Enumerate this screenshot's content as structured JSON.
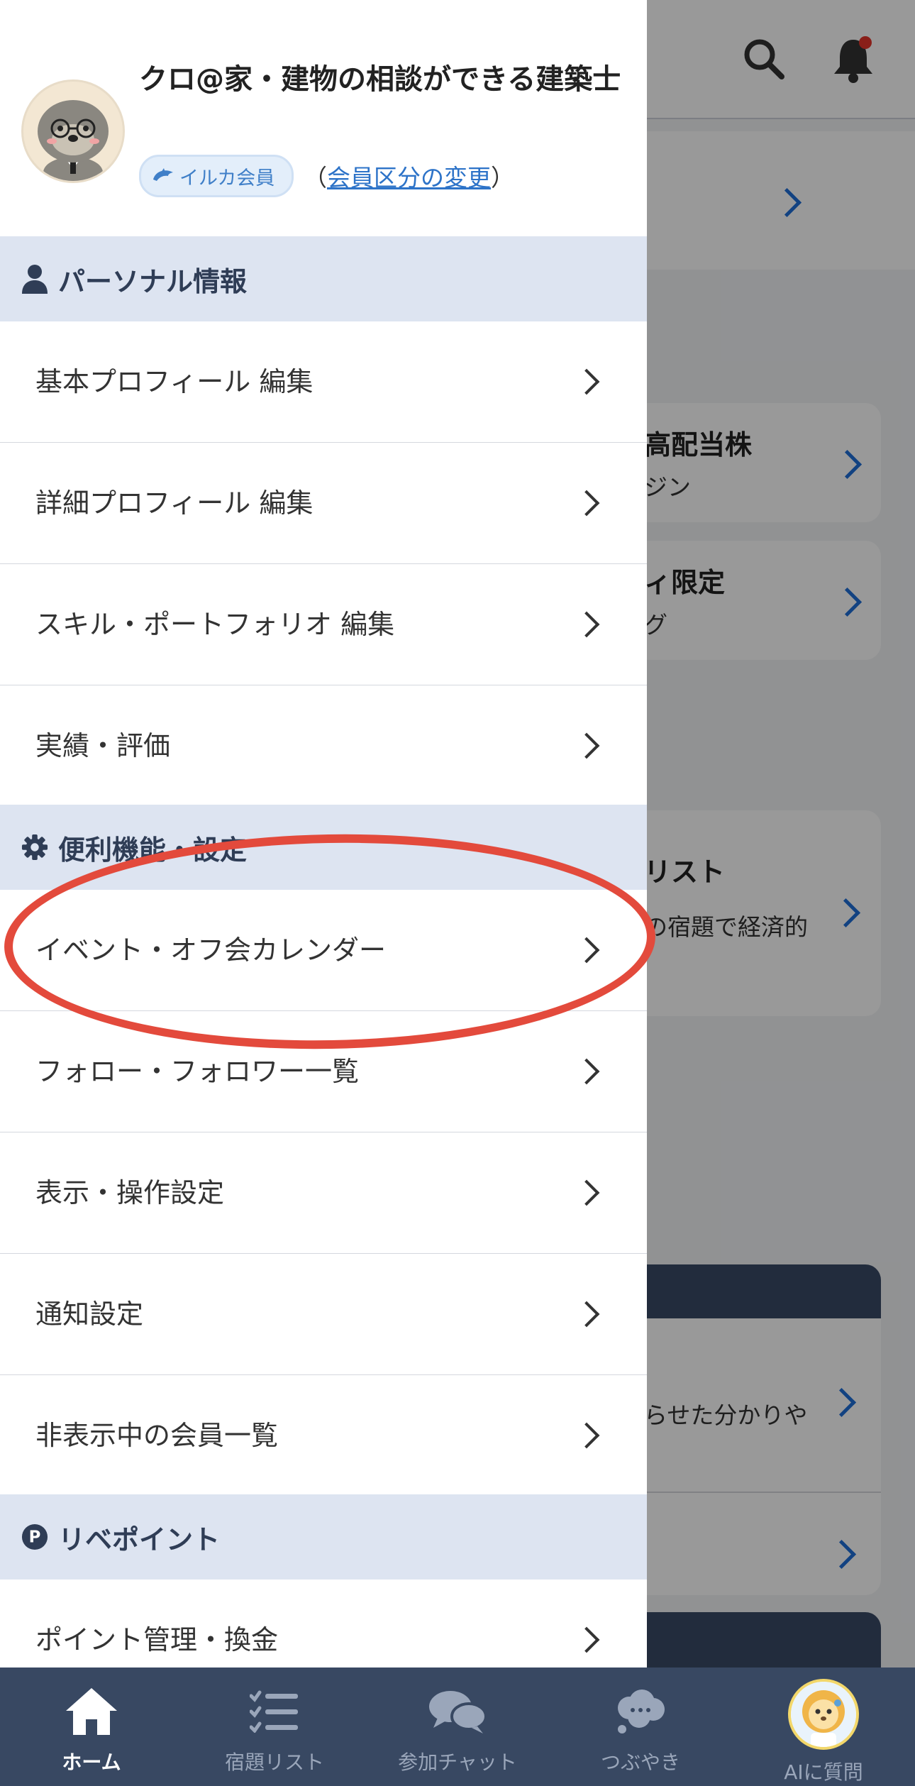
{
  "background": {
    "cards": [
      {
        "title": "高配当株",
        "sub": "ジン"
      },
      {
        "title": "ィ限定",
        "sub": "グ"
      },
      {
        "title": "リスト",
        "sub": "の宿題で経済的"
      }
    ],
    "lower_snippet": "らせた分かりや"
  },
  "profile": {
    "name": "クロ@家・建物の相談ができる建築士",
    "badge": "イルカ会員",
    "paren_open": "（",
    "change_link": "会員区分の変更",
    "paren_close": "）"
  },
  "sections": [
    {
      "label": "パーソナル情報",
      "icon": "person-icon"
    },
    {
      "label": "便利機能・設定",
      "icon": "gear-icon"
    },
    {
      "label": "リベポイント",
      "icon": "point-icon"
    }
  ],
  "menu": {
    "personal": [
      "基本プロフィール 編集",
      "詳細プロフィール 編集",
      "スキル・ポートフォリオ 編集",
      "実績・評価"
    ],
    "settings": [
      "イベント・オフ会カレンダー",
      "フォロー・フォロワー一覧",
      "表示・操作設定",
      "通知設定",
      "非表示中の会員一覧"
    ],
    "points": [
      "ポイント管理・換金"
    ]
  },
  "tabs": [
    {
      "label": "ホーム",
      "icon": "home-icon",
      "active": true
    },
    {
      "label": "宿題リスト",
      "icon": "checklist-icon",
      "active": false
    },
    {
      "label": "参加チャット",
      "icon": "chat-bubbles-icon",
      "active": false
    },
    {
      "label": "つぶやき",
      "icon": "cloud-bubble-icon",
      "active": false
    },
    {
      "label": "AIに質問",
      "icon": "ai-avatar-icon",
      "active": false
    }
  ],
  "colors": {
    "accent_blue": "#1f6fd8",
    "section_bg": "#dde4f1",
    "tabbar_bg": "#384862",
    "highlight_ring": "#e34a3c",
    "notification_dot": "#e5352b"
  }
}
